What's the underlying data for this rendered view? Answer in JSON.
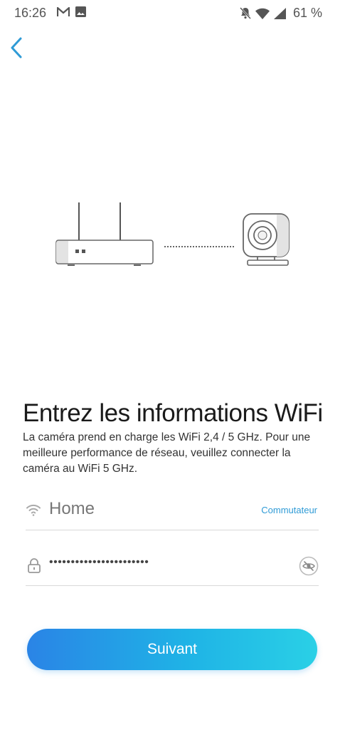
{
  "status_bar": {
    "time": "16:26",
    "battery": "61 %",
    "left_icons": [
      "gmail-icon",
      "image-icon"
    ],
    "right_icons": [
      "mute-icon",
      "wifi-signal-icon",
      "cell-signal-icon"
    ]
  },
  "header": {
    "back_icon": "chevron-left-icon",
    "accent_color": "#2f9bd6"
  },
  "illustration": {
    "left_device": "router-icon",
    "right_device": "camera-icon"
  },
  "main": {
    "title": "Entrez les informations WiFi",
    "description": "La caméra prend en charge les WiFi 2,4 / 5 GHz. Pour une meilleure performance de réseau, veuillez connecter la caméra au WiFi 5 GHz."
  },
  "ssid_field": {
    "icon": "wifi-icon",
    "value": "Home",
    "switch_label": "Commutateur"
  },
  "password_field": {
    "icon": "lock-icon",
    "value": "•••••••••••••••••••••••",
    "toggle_icon": "eye-off-icon"
  },
  "footer": {
    "next_label": "Suivant",
    "gradient_start": "#2a84e6",
    "gradient_end": "#2ad0e6"
  }
}
